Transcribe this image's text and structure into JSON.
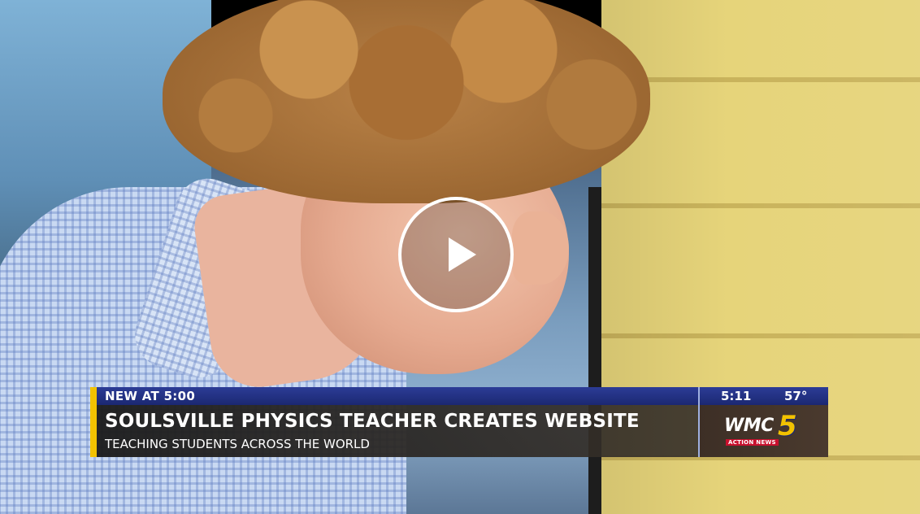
{
  "video": {
    "play_label": "Play video"
  },
  "lower_third": {
    "label": "NEW AT 5:00",
    "headline": "SOULSVILLE PHYSICS TEACHER CREATES WEBSITE",
    "subheadline": "TEACHING STUDENTS ACROSS THE WORLD",
    "time": "5:11",
    "temperature": "57°",
    "logo_text": "WMC",
    "logo_number": "5",
    "logo_sub": "ACTION NEWS"
  },
  "colors": {
    "accent_yellow": "#f2c200",
    "bar_blue": "#1b2872",
    "logo_red": "#c8102e"
  },
  "icons": {
    "play": "play-icon"
  }
}
